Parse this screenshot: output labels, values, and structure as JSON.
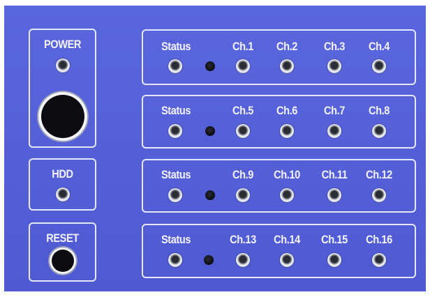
{
  "left": {
    "power_label": "POWER",
    "hdd_label": "HDD",
    "reset_label": "RESET"
  },
  "rows": [
    {
      "status_label": "Status",
      "channels": [
        "Ch.1",
        "Ch.2",
        "Ch.3",
        "Ch.4"
      ]
    },
    {
      "status_label": "Status",
      "channels": [
        "Ch.5",
        "Ch.6",
        "Ch.7",
        "Ch.8"
      ]
    },
    {
      "status_label": "Status",
      "channels": [
        "Ch.9",
        "Ch.10",
        "Ch.11",
        "Ch.12"
      ]
    },
    {
      "status_label": "Status",
      "channels": [
        "Ch.13",
        "Ch.14",
        "Ch.15",
        "Ch.16"
      ]
    }
  ],
  "colors": {
    "panel": "#5560d8",
    "outline": "#e7e9fb",
    "text": "#f2f3ff"
  }
}
